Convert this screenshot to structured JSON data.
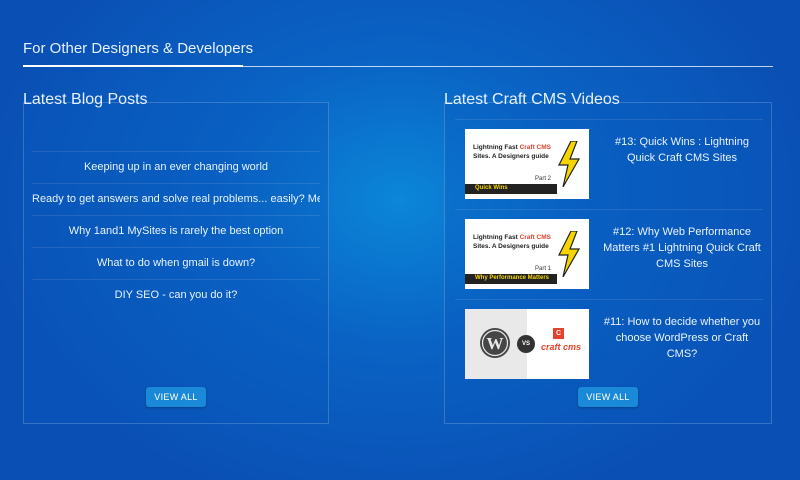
{
  "section": {
    "title": "For Other Designers & Developers"
  },
  "blog": {
    "title": "Latest Blog Posts",
    "posts": [
      "Keeping up in an ever changing world",
      "Ready to get answers and solve real problems... easily? Meet Kaizen.",
      "Why 1and1 MySites is rarely the best option",
      "What to do when gmail is down?",
      "DIY SEO - can you do it?"
    ],
    "view_all": "VIEW ALL"
  },
  "videos": {
    "title": "Latest Craft CMS Videos",
    "items": [
      {
        "title": "#13: Quick Wins : Lightning Quick Craft CMS Sites",
        "thumb": {
          "line1_a": "Lightning Fast ",
          "line1_b": "Craft CMS",
          "line2": "Sites. A Designers guide",
          "part": "Part 2",
          "bar": "Quick Wins"
        }
      },
      {
        "title": "#12: Why Web Performance Matters #1 Lightning Quick Craft CMS Sites",
        "thumb": {
          "line1_a": "Lightning Fast ",
          "line1_b": "Craft CMS",
          "line2": "Sites. A Designers guide",
          "part": "Part 1",
          "bar": "Why Performance Matters"
        }
      },
      {
        "title": "#11: How to decide whether you choose WordPress or Craft CMS?",
        "thumb": {
          "vs": "VS",
          "cc_box": "C",
          "cc_text": "craft cms"
        }
      }
    ],
    "view_all": "VIEW ALL"
  },
  "colors": {
    "accent": "#e5422b",
    "bolt": "#f5d400",
    "button": "#1a8ad8"
  },
  "icons": {
    "bolt": "lightning-bolt-icon",
    "wordpress": "wordpress-logo-icon"
  }
}
